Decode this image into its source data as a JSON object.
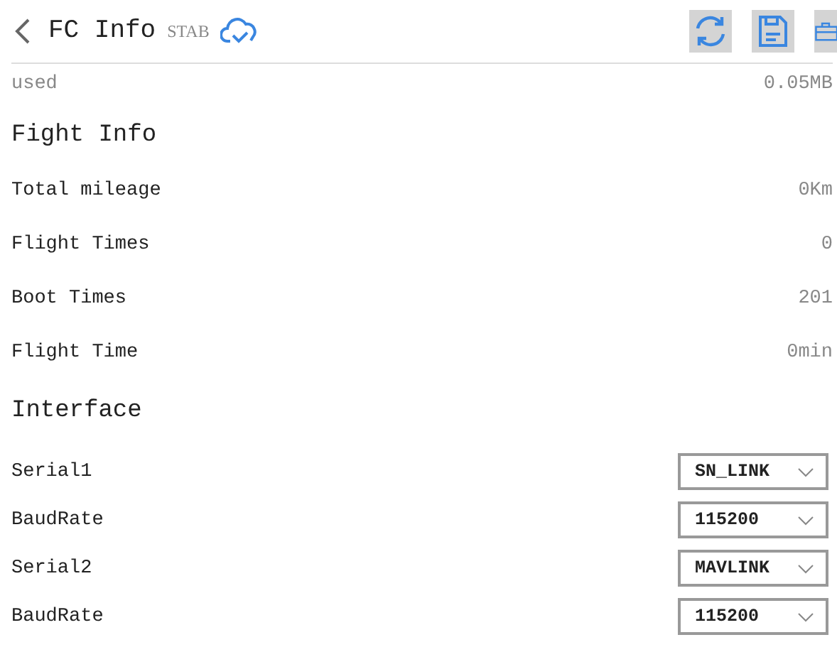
{
  "header": {
    "title": "FC Info",
    "mode": "STAB"
  },
  "storage": {
    "label": "used",
    "value": "0.05MB"
  },
  "sections": [
    {
      "title": "Fight Info",
      "rows": [
        {
          "label": "Total mileage",
          "value": "0Km"
        },
        {
          "label": "Flight Times",
          "value": "0"
        },
        {
          "label": "Boot Times",
          "value": "201"
        },
        {
          "label": "Flight Time",
          "value": "0min"
        }
      ]
    },
    {
      "title": "Interface",
      "selects": [
        {
          "label": "Serial1",
          "value": "SN_LINK"
        },
        {
          "label": "BaudRate",
          "value": "115200"
        },
        {
          "label": "Serial2",
          "value": "MAVLINK"
        },
        {
          "label": "BaudRate",
          "value": "115200"
        }
      ]
    }
  ]
}
